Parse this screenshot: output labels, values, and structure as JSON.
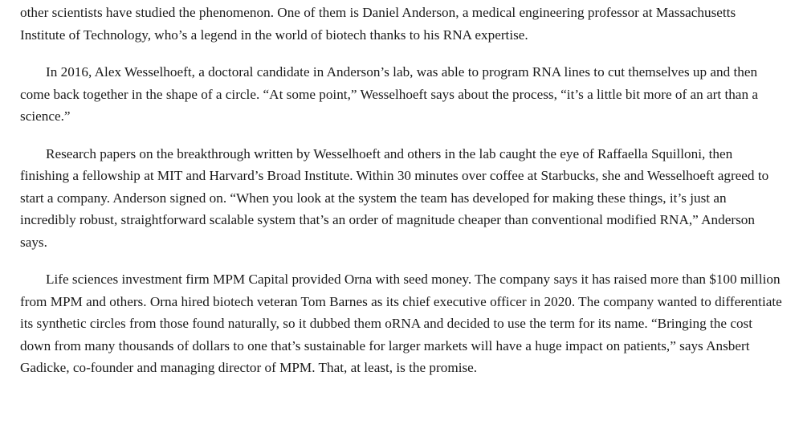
{
  "article": {
    "partial_top_line": "other scientists have studied the phenomenon. One of them is Daniel Anderson, a medical engineering professor at Massachusetts Institute of Technology, who’s a legend in the world of biotech thanks to his RNA expertise.",
    "paragraphs": [
      "In 2016, Alex Wesselhoeft, a doctoral candidate in Anderson’s lab, was able to program RNA lines to cut themselves up and then come back together in the shape of a circle. “At some point,” Wesselhoeft says about the process, “it’s a little bit more of an art than a science.”",
      "Research papers on the breakthrough written by Wesselhoeft and others in the lab caught the eye of Raffaella Squilloni, then finishing a fellowship at MIT and Harvard’s Broad Institute. Within 30 minutes over coffee at Starbucks, she and Wesselhoeft agreed to start a company. Anderson signed on. “When you look at the system the team has developed for making these things, it’s just an incredibly robust, straightforward scalable system that’s an order of magnitude cheaper than conventional modified RNA,” Anderson says.",
      "Life sciences investment firm MPM Capital provided Orna with seed money. The company says it has raised more than $100 million from MPM and others. Orna hired biotech veteran Tom Barnes as its chief executive officer in 2020. The company wanted to differentiate its synthetic circles from those found naturally, so it dubbed them oRNA and decided to use the term for its name. “Bringing the cost down from many thousands of dollars to one that’s sustainable for larger markets will have a huge impact on patients,” says Ansbert Gadicke, co-founder and managing director of MPM. That, at least, is the promise."
    ]
  }
}
